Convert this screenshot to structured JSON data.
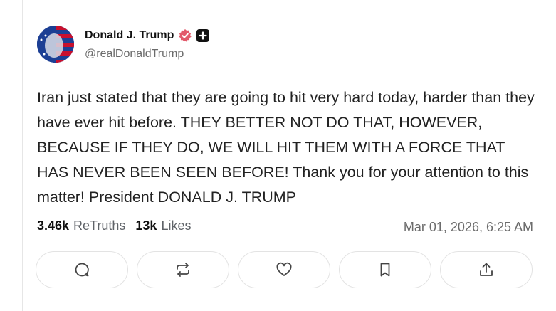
{
  "post": {
    "author_name": "Donald J. Trump",
    "handle": "@realDonaldTrump",
    "text": "Iran just stated that they are going to hit very hard today, harder than they have ever hit before. THEY BETTER NOT DO THAT, HOWEVER, BECAUSE IF THEY DO, WE WILL HIT THEM WITH A FORCE THAT HAS NEVER BEEN SEEN BEFORE! Thank you for your attention to this matter! President DONALD J. TRUMP",
    "retruths_count": "3.46k",
    "retruths_label": "ReTruths",
    "likes_count": "13k",
    "likes_label": "Likes",
    "timestamp": "Mar 01, 2026, 6:25 AM"
  },
  "icons": {
    "verified": "verified-badge-icon",
    "plus": "plus-badge-icon",
    "reply": "comment-icon",
    "retruth": "repost-icon",
    "like": "heart-icon",
    "bookmark": "bookmark-icon",
    "share": "share-icon"
  },
  "colors": {
    "verified_badge": "#e25a6b",
    "muted_text": "#6b6b6b",
    "border": "#e3e3e3"
  }
}
